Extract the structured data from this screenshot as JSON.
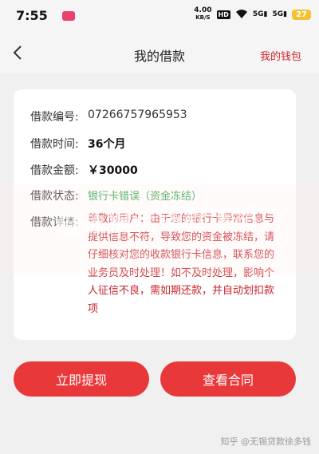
{
  "status_bar": {
    "time": "7:55",
    "net_speed_value": "4.00",
    "net_speed_unit": "KB/S",
    "hd_badge": "HD",
    "signal_5g_1": "5G",
    "signal_5g_2": "5G",
    "battery": "27"
  },
  "nav": {
    "title": "我的借款",
    "right_link": "我的钱包"
  },
  "loan": {
    "number_label": "借款编号:",
    "number_value": "07266757965953",
    "time_label": "借款时间:",
    "time_value": "36个月",
    "amount_label": "借款金额:",
    "amount_value": "￥30000",
    "status_label": "借款状态:",
    "status_value": "银行卡错误（资金冻结）",
    "detail_label": "借款详情:",
    "detail_text": "尊敬的用户：由于您的银行卡异常信息与提供信息不符，导致您的资金被冻结，请仔细核对您的收款银行卡信息，联系您的业务员及时处理！如不及时处理，影响个人征信不良，需如期还款，并自动划扣款项"
  },
  "buttons": {
    "withdraw": "立即提现",
    "contract": "查看合同"
  },
  "overlay": {
    "watermark": "借款提示钱款冻结",
    "source": "知乎 @无锡贷款徐多钱"
  },
  "colors": {
    "accent": "#e8383a",
    "status_green": "#2aa148",
    "notice_red": "#c8232b"
  }
}
